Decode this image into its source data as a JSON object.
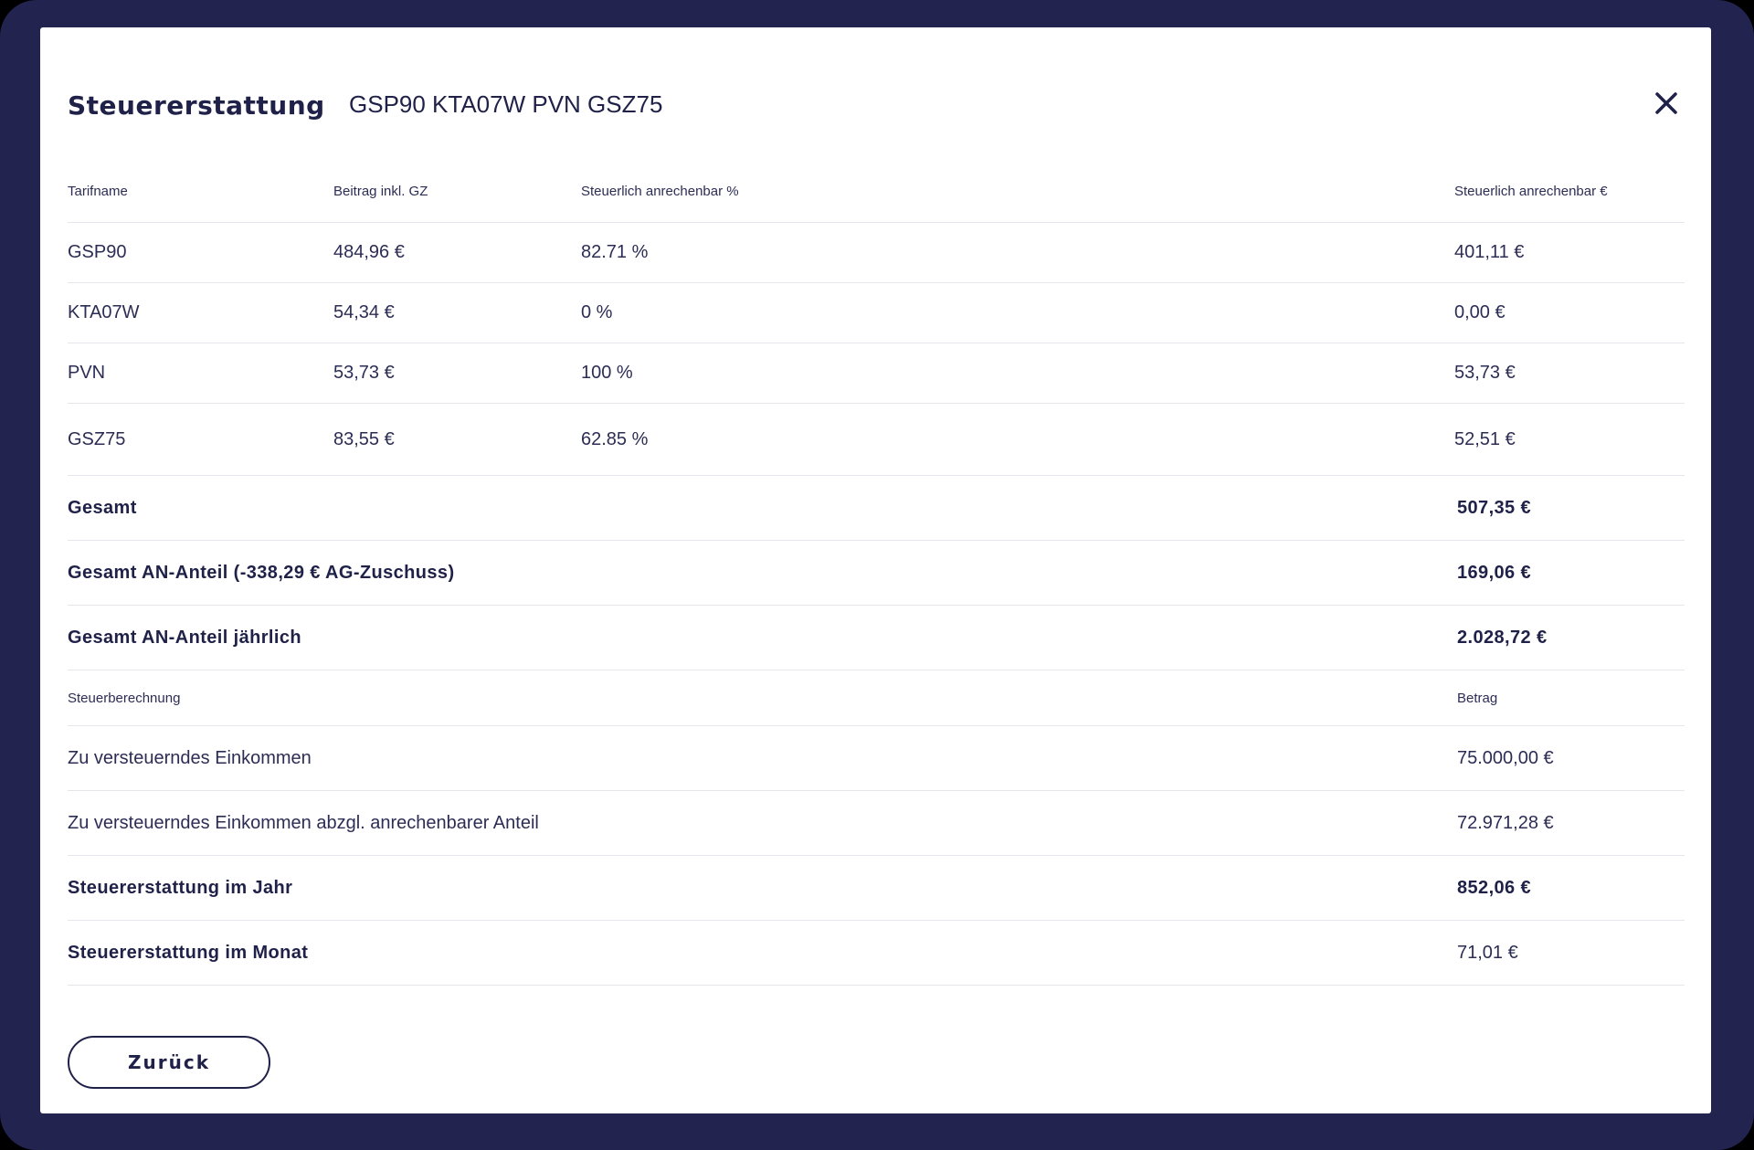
{
  "modal": {
    "title": "Steuererstattung",
    "subtitle": "GSP90 KTA07W PVN GSZ75",
    "close_icon": "close-icon"
  },
  "tariff_table": {
    "headers": [
      "Tarifname",
      "Beitrag inkl. GZ",
      "Steuerlich anrechenbar %",
      "Steuerlich anrechenbar €"
    ],
    "rows": [
      {
        "name": "GSP90",
        "amount": "484,96 €",
        "percent": "82.71 %",
        "deductible": "401,11 €"
      },
      {
        "name": "KTA07W",
        "amount": "54,34 €",
        "percent": "0 %",
        "deductible": "0,00 €"
      },
      {
        "name": "PVN",
        "amount": "53,73 €",
        "percent": "100 %",
        "deductible": "53,73 €"
      },
      {
        "name": "GSZ75",
        "amount": "83,55 €",
        "percent": "62.85 %",
        "deductible": "52,51 €"
      }
    ],
    "totals": [
      {
        "label": "Gesamt",
        "value": "507,35 €"
      },
      {
        "label": "Gesamt AN-Anteil (-338,29 € AG-Zuschuss)",
        "value": "169,06 €"
      },
      {
        "label": "Gesamt AN-Anteil jährlich",
        "value": "2.028,72 €"
      }
    ]
  },
  "tax_table": {
    "headers": [
      "Steuerberechnung",
      "Betrag"
    ],
    "rows": [
      {
        "label": "Zu versteuerndes Einkommen",
        "value": "75.000,00 €",
        "bold": false
      },
      {
        "label": "Zu versteuerndes Einkommen abzgl. anrechenbarer Anteil",
        "value": "72.971,28 €",
        "bold": false
      },
      {
        "label": "Steuererstattung im Jahr",
        "value": "852,06 €",
        "bold": true
      },
      {
        "label": "Steuererstattung im Monat",
        "value": "71,01 €",
        "bold": "label-only"
      }
    ]
  },
  "footer": {
    "back_label": "Zurück"
  },
  "colors": {
    "frame": "#22234f",
    "text": "#1f2148",
    "divider": "#e6e6ec"
  }
}
